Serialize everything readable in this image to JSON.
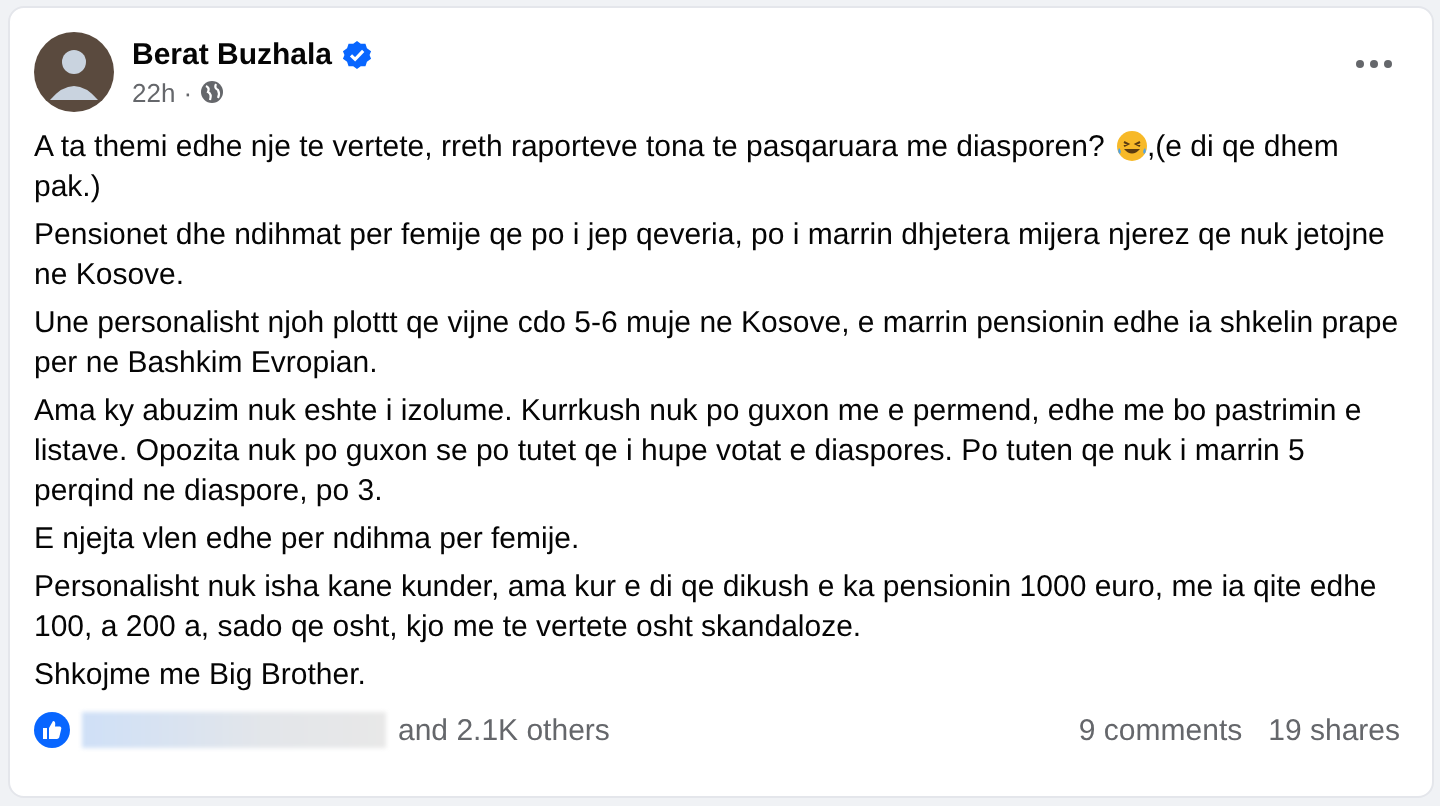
{
  "post": {
    "author": "Berat Buzhala",
    "verified": true,
    "time": "22h",
    "separator": "·",
    "intro": {
      "before": "A ta themi edhe nje te vertete, rreth raporteve tona te pasqaruara me diasporen?",
      "after": ",(e di qe dhem",
      "continued": "pak.)"
    },
    "paragraphs": [
      "Pensionet dhe ndihmat per femije qe po i jep qeveria, po i marrin dhjetera mijera njerez qe nuk jetojne ne Kosove.",
      "Une personalisht njoh plottt qe vijne cdo 5-6 muje ne Kosove, e marrin pensionin edhe ia shkelin prape per ne Bashkim Evropian.",
      "Ama ky abuzim nuk eshte i izolume. Kurrkush nuk po guxon me e permend, edhe me bo pastrimin e listave. Opozita nuk po guxon se po tutet qe i hupe votat e diaspores. Po tuten qe nuk i marrin 5 perqind ne diaspore, po 3.",
      "E njejta vlen edhe per ndihma per femije.",
      "Personalisht nuk isha kane kunder, ama kur e di qe dikush e ka pensionin 1000 euro, me ia qite edhe 100, a 200 a, sado qe osht, kjo me te vertete osht skandaloze.",
      "Shkojme me Big Brother."
    ],
    "reactions": {
      "others": "and 2.1K others",
      "comments": "9 comments",
      "shares": "19 shares"
    }
  }
}
